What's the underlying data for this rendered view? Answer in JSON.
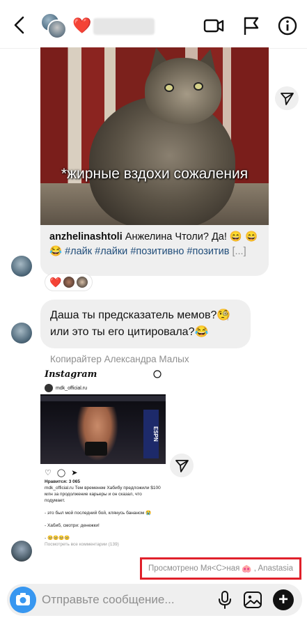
{
  "header": {
    "heart": "❤️"
  },
  "post": {
    "image_caption": "*жирные вздохи сожаления",
    "author": "anzhelinashtoli",
    "text": "Анжелина Чтоли? Да! 😄 😄 😂",
    "tags": "#лайк #лайки #позитивно #позитив",
    "more": "[...]"
  },
  "reactions": {
    "heart": "❤️"
  },
  "bubble": {
    "line1": "Даша ты предсказатель мемов?🧐",
    "line2": "или это ты его цитировала?😂"
  },
  "forward_label": "Копирайтер Александра Малых",
  "shared_post": {
    "logo": "Instagram",
    "username": "mdk_official.ru",
    "espn": "ESPN",
    "likes": "Нравится: 3 065",
    "caption": "mdk_official.ru Тем временем Хабибу предложили $100 млн за продолжение карьеры и он сказал, что подумает.",
    "quote1": "- это был мой последний бой, клянусь бананом 😭",
    "quote2": "- Хабиб, смотри: денежки!",
    "emojis": "- 🥺🥺🥺🥺",
    "view_comments": "Посмотреть все комментарии (139)"
  },
  "seen": {
    "text_before": "Просмотрено Мя<С>ная",
    "pig": "🐽",
    "text_after": ", Anastasia"
  },
  "composer": {
    "placeholder": "Отправьте сообщение..."
  }
}
